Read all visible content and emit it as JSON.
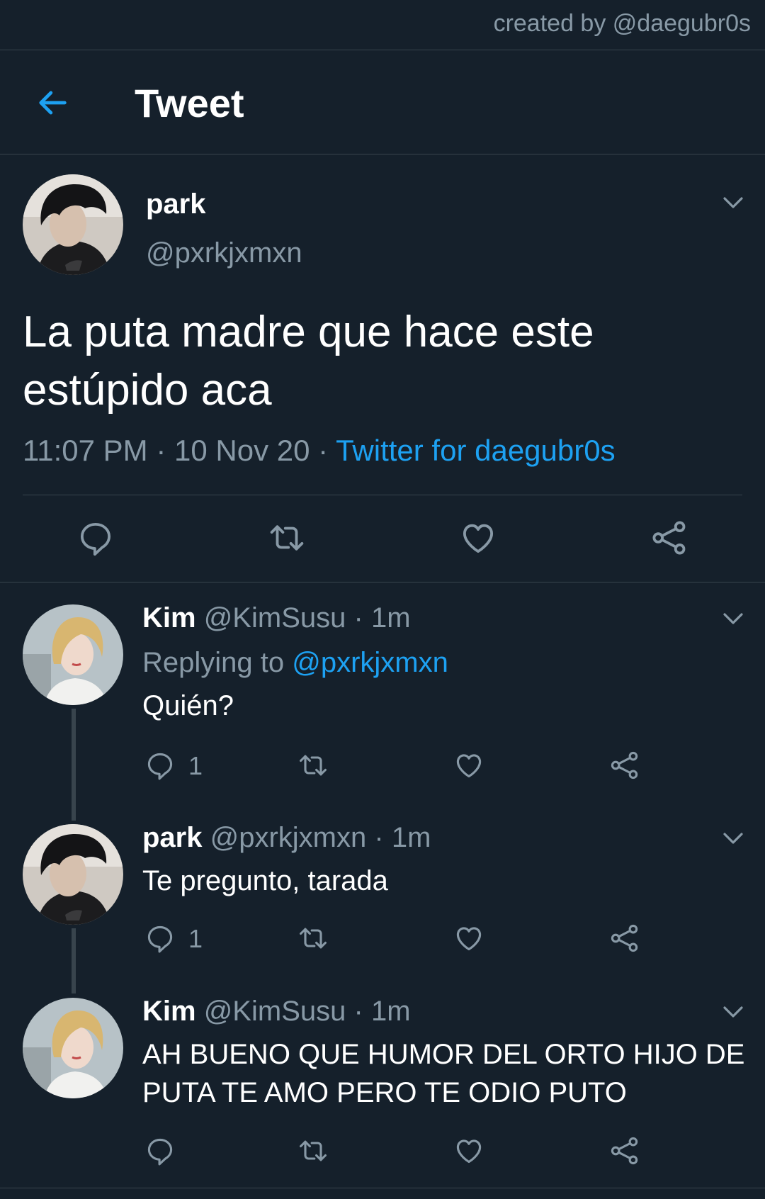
{
  "watermark": "created by @daegubr0s",
  "header": {
    "title": "Tweet",
    "back_icon": "arrow-left-icon"
  },
  "colors": {
    "background": "#15202b",
    "accent": "#1da1f2",
    "muted": "#8899a6",
    "divider": "#38444d"
  },
  "main_tweet": {
    "name": "park",
    "handle": "@pxrkjxmxn",
    "text": "La puta madre que hace este estúpido aca",
    "time": "11:07 PM",
    "sep": "·",
    "date": "10 Nov 20",
    "source": "Twitter for daegubr0s"
  },
  "replies": [
    {
      "name": "Kim",
      "handle": "@KimSusu",
      "sep": "·",
      "time": "1m",
      "replying_label": "Replying to",
      "replying_to": "@pxrkjxmxn",
      "text": "Quién?",
      "reply_count": "1"
    },
    {
      "name": "park",
      "handle": "@pxrkjxmxn",
      "sep": "·",
      "time": "1m",
      "text": "Te pregunto, tarada",
      "reply_count": "1"
    },
    {
      "name": "Kim",
      "handle": "@KimSusu",
      "sep": "·",
      "time": "1m",
      "text": "AH BUENO QUE HUMOR DEL ORTO HIJO DE PUTA TE AMO PERO TE ODIO PUTO",
      "reply_count": ""
    }
  ]
}
